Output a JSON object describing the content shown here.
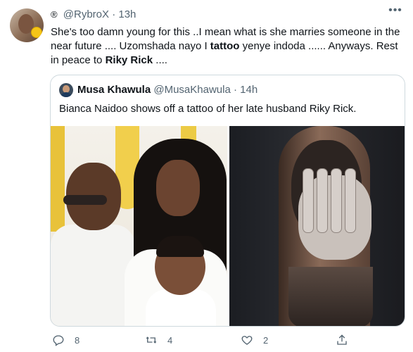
{
  "author": {
    "icon": "registered-icon",
    "handle": "@RybroX",
    "separator": "·",
    "time": "13h"
  },
  "tweet_text": {
    "part1": "She's too damn young for this ..I mean what is she marries someone in the near future .... Uzomshada nayo I ",
    "bold1": "tattoo",
    "part2": " yenye indoda ...... Anyways. Rest in peace to ",
    "bold2": "Riky Rick",
    "part3": " ...."
  },
  "quoted": {
    "name": "Musa Khawula",
    "handle": "@MusaKhawula",
    "separator": "·",
    "time": "14h",
    "text": "Bianca Naidoo shows off a tattoo of her late husband Riky Rick."
  },
  "actions": {
    "replies": "8",
    "retweets": "4",
    "likes": "2"
  },
  "icons": [
    "more-icon",
    "reply-icon",
    "retweet-icon",
    "like-icon",
    "share-icon"
  ],
  "colors": {
    "secondary_text": "#536471",
    "border": "#cfd9de",
    "text": "#0f1419"
  }
}
